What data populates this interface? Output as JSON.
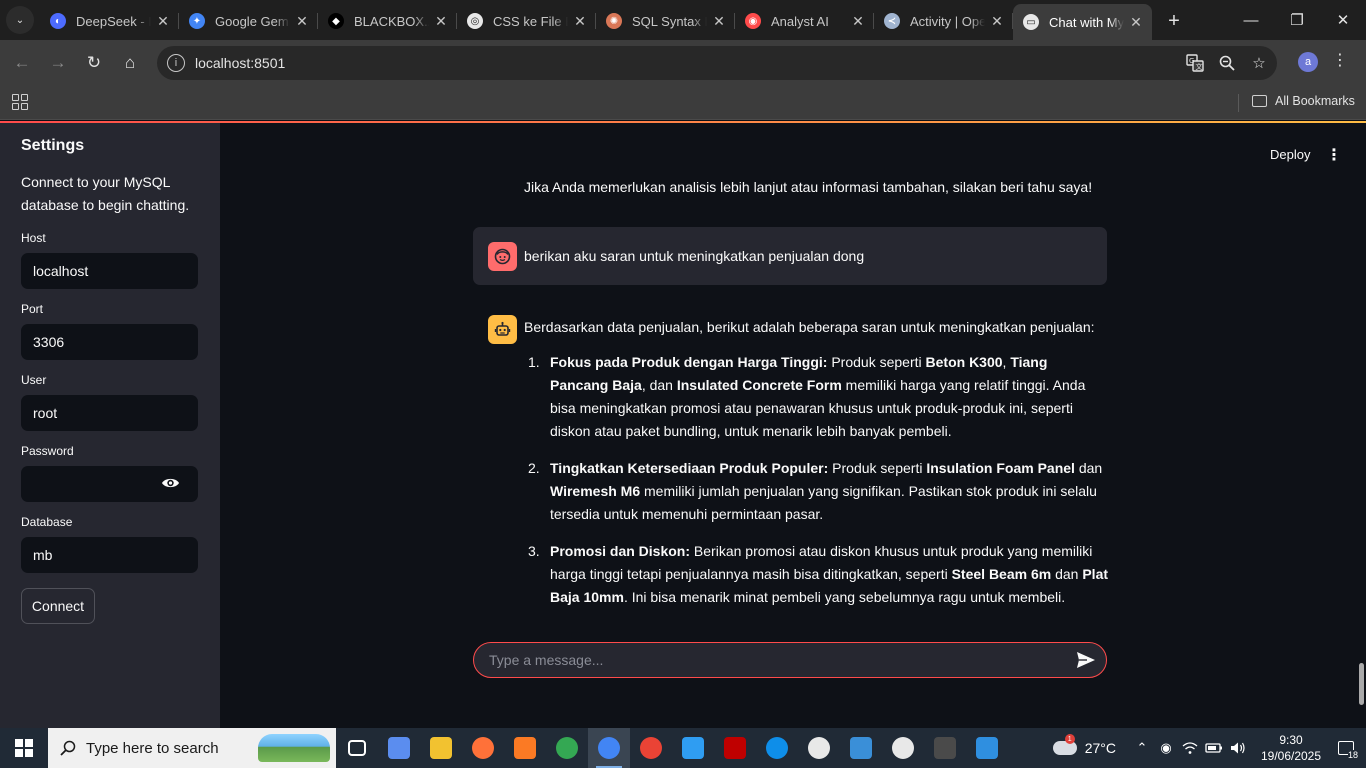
{
  "browser": {
    "tabs": [
      {
        "title": "DeepSeek - Into the Unknown",
        "fav_color": "#4d6bfe",
        "fav_glyph": "◐",
        "active": false
      },
      {
        "title": "Google Gemini",
        "fav_color": "#4285f4",
        "fav_glyph": "✦",
        "active": false
      },
      {
        "title": "BLACKBOX.AI",
        "fav_color": "#000000",
        "fav_glyph": "◆",
        "active": false
      },
      {
        "title": "CSS ke File Eksternal",
        "fav_color": "#e8e8e8",
        "fav_glyph": "◎",
        "active": false
      },
      {
        "title": "SQL Syntax Error",
        "fav_color": "#d97757",
        "fav_glyph": "✺",
        "active": false
      },
      {
        "title": "Analyst AI",
        "fav_color": "#ff4b4b",
        "fav_glyph": "◉",
        "active": false
      },
      {
        "title": "Activity | Open",
        "fav_color": "#a0b4d0",
        "fav_glyph": "≺",
        "active": false
      },
      {
        "title": "Chat with MySQL",
        "fav_color": "#e8e8e8",
        "fav_glyph": "▭",
        "active": true
      }
    ],
    "url": "localhost:8501",
    "profile_initial": "a",
    "all_bookmarks_label": "All Bookmarks"
  },
  "sidebar": {
    "title": "Settings",
    "description": "Connect to your MySQL database to begin chatting.",
    "fields": {
      "host": {
        "label": "Host",
        "value": "localhost"
      },
      "port": {
        "label": "Port",
        "value": "3306"
      },
      "user": {
        "label": "User",
        "value": "root"
      },
      "password": {
        "label": "Password",
        "value": ""
      },
      "database": {
        "label": "Database",
        "value": "mb"
      }
    },
    "connect_label": "Connect"
  },
  "header": {
    "deploy_label": "Deploy"
  },
  "chat": {
    "previous_tail": "Jika Anda memerlukan analisis lebih lanjut atau informasi tambahan, silakan beri tahu saya!",
    "user_message": "berikan aku saran untuk meningkatkan penjualan dong",
    "bot_intro": "Berdasarkan data penjualan, berikut adalah beberapa saran untuk meningkatkan penjualan:",
    "bot_items": [
      {
        "num": "1.",
        "heading": "Fokus pada Produk dengan Harga Tinggi",
        "t1": "Produk seperti ",
        "p1": "Beton K300",
        "t2": ", ",
        "p2": "Tiang Pancang Baja",
        "t3": ", dan ",
        "p3": "Insulated Concrete Form",
        "t4": " memiliki harga yang relatif tinggi. Anda bisa meningkatkan promosi atau penawaran khusus untuk produk-produk ini, seperti diskon atau paket bundling, untuk menarik lebih banyak pembeli."
      },
      {
        "num": "2.",
        "heading": "Tingkatkan Ketersediaan Produk Populer",
        "t1": "Produk seperti ",
        "p1": "Insulation Foam Panel",
        "t2": " dan ",
        "p2": "Wiremesh M6",
        "t3": " memiliki jumlah penjualan yang signifikan. Pastikan stok produk ini selalu tersedia untuk memenuhi permintaan pasar."
      },
      {
        "num": "3.",
        "heading": "Promosi dan Diskon",
        "t1": "Berikan promosi atau diskon khusus untuk produk yang memiliki harga tinggi tetapi penjualannya masih bisa ditingkatkan, seperti ",
        "p1": "Steel Beam 6m",
        "t2": " dan ",
        "p2": "Plat Baja 10mm",
        "t3": ". Ini bisa menarik minat pembeli yang sebelumnya ragu untuk membeli."
      }
    ],
    "input_placeholder": "Type a message..."
  },
  "taskbar": {
    "search_placeholder": "Type here to search",
    "temperature": "27°C",
    "weather_badge": "1",
    "time": "9:30",
    "date": "19/06/2025",
    "notification_count": "18",
    "apps": [
      {
        "name": "task-view",
        "color": "#ffffff"
      },
      {
        "name": "copilot",
        "color": "#5b8def"
      },
      {
        "name": "file-explorer",
        "color": "#f2c230"
      },
      {
        "name": "firefox",
        "color": "#ff7139"
      },
      {
        "name": "xampp",
        "color": "#fb7a24"
      },
      {
        "name": "chrome",
        "color": "#34a853"
      },
      {
        "name": "chrome-profile",
        "color": "#4285f4"
      },
      {
        "name": "chrome-alt",
        "color": "#ea4335"
      },
      {
        "name": "vscode",
        "color": "#2f9df2"
      },
      {
        "name": "filezilla",
        "color": "#bf0000"
      },
      {
        "name": "teamviewer",
        "color": "#0e8ee9"
      },
      {
        "name": "soccer",
        "color": "#e8e8e8"
      },
      {
        "name": "app-blue",
        "color": "#3a8fd8"
      },
      {
        "name": "soccer-alt",
        "color": "#e8e8e8"
      },
      {
        "name": "terminal",
        "color": "#4a4a4a"
      },
      {
        "name": "paint",
        "color": "#2f8fe0"
      }
    ]
  },
  "colors": {
    "accent": "#ff4b4b",
    "bot_avatar": "#ffbd45",
    "user_avatar": "#ff6c6c",
    "bg": "#0e1117",
    "sidebar_bg": "#262730"
  }
}
